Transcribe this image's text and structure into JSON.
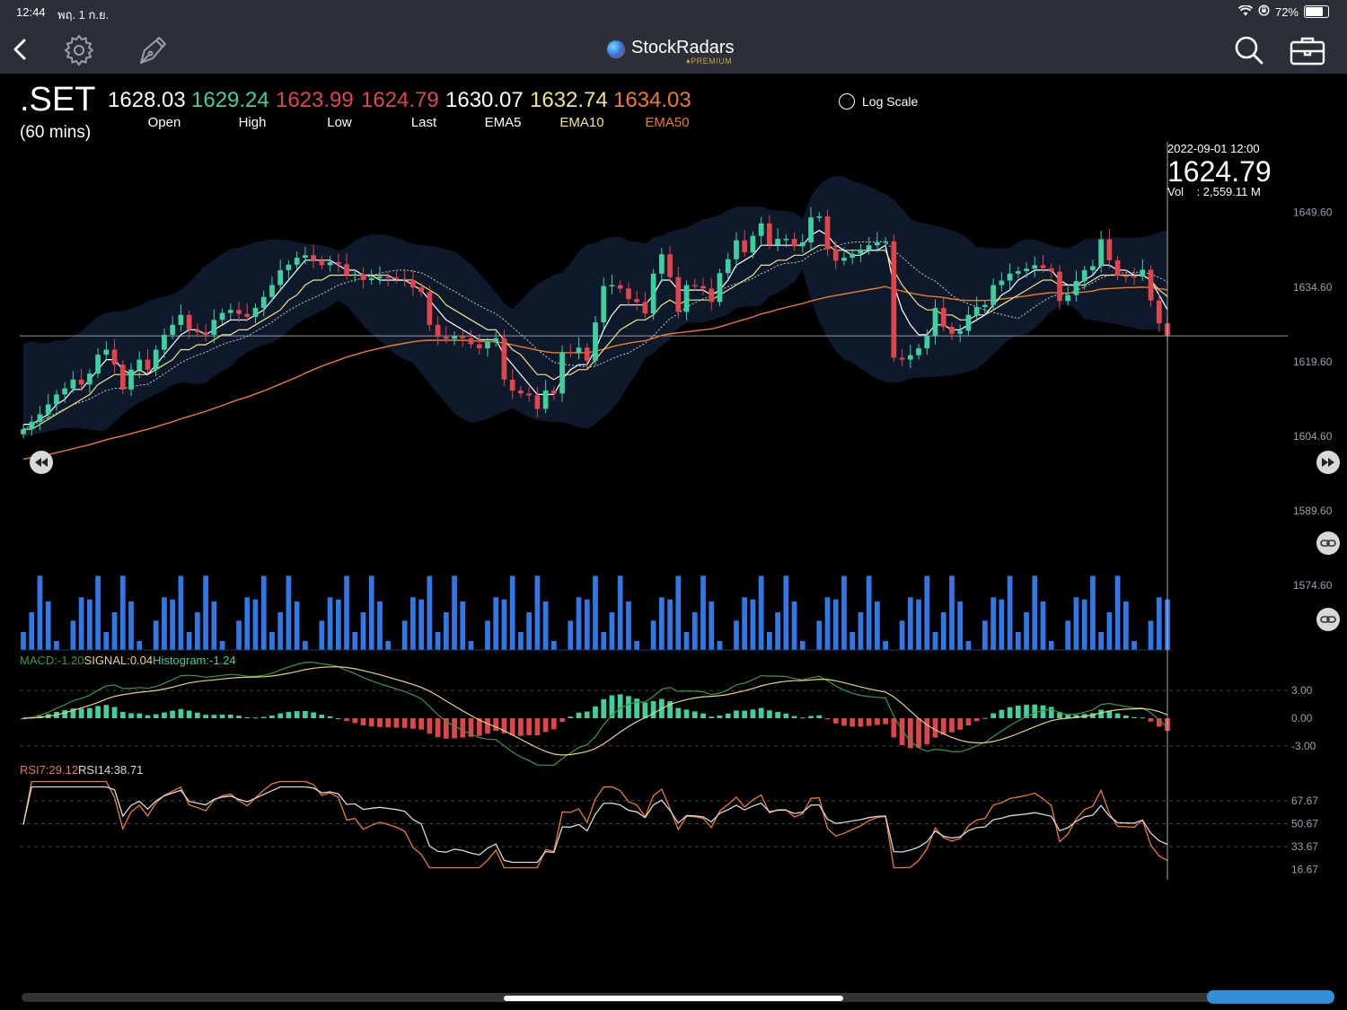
{
  "status_bar": {
    "time": "12:44",
    "date": "พฤ. 1 ก.ย.",
    "battery": "72%",
    "battery_level": 0.72
  },
  "brand": {
    "name": "StockRadars",
    "tier": "PREMIUM"
  },
  "quote": {
    "symbol": ".SET",
    "interval": "(60 mins)",
    "fields": [
      {
        "label": "Open",
        "value": "1628.03",
        "color": "#ffffff"
      },
      {
        "label": "High",
        "value": "1629.24",
        "color": "#3dd1a0"
      },
      {
        "label": "Low",
        "value": "1623.99",
        "color": "#e0454b"
      },
      {
        "label": "Last",
        "value": "1624.79",
        "color": "#e0454b"
      },
      {
        "label": "EMA5",
        "value": "1630.07",
        "color": "#ffffff"
      },
      {
        "label": "EMA10",
        "value": "1632.74",
        "color": "#f2e48a"
      },
      {
        "label": "EMA50",
        "value": "1634.03",
        "color": "#ee7a2c"
      }
    ]
  },
  "log_scale": {
    "label": "Log Scale",
    "checked": false
  },
  "crosshair": {
    "datetime": "2022-09-01 12:00",
    "price": "1624.79",
    "volume": "Vol    : 2,559.11 M"
  },
  "indicators": {
    "macd": {
      "macd": "MACD:-1.20",
      "signal": "SIGNAL:0.04",
      "histogram": "Histogram:-1.24"
    },
    "rsi": {
      "rsi7": "RSI7:29.12",
      "rsi14": "RSI14:38.71"
    }
  },
  "colors": {
    "up": "#3dd1a0",
    "down": "#e0454b",
    "volume": "#2f78e6",
    "band": "#0f1b2e",
    "ema5": "#ffffff",
    "ema10": "#f2e48a",
    "ema50": "#ee7a2c",
    "macd_line": "#3a9a3a",
    "signal_line": "#e6d37a",
    "rsi7": "#ee7a2c",
    "rsi14": "#d9d9d9"
  },
  "chart_data": {
    "type": "line",
    "price_axis": {
      "ticks": [
        "1649.60",
        "1634.60",
        "1619.60",
        "1604.60",
        "1589.60",
        "1574.60"
      ],
      "ylim": [
        1571,
        1662
      ]
    },
    "macd_axis": {
      "ticks": [
        "3.00",
        "0.00",
        "-3.00"
      ]
    },
    "rsi_axis": {
      "ticks": [
        "67.67",
        "50.67",
        "33.67",
        "16.67"
      ]
    },
    "candles_close": [
      1606,
      1607.5,
      1609,
      1611,
      1613,
      1614.2,
      1616,
      1615,
      1617.2,
      1621,
      1622,
      1619,
      1614,
      1618,
      1620,
      1618,
      1622,
      1625,
      1627,
      1629,
      1626,
      1625.5,
      1625,
      1628,
      1629.4,
      1630,
      1629.2,
      1628.6,
      1630.4,
      1632.6,
      1635,
      1638,
      1639.1,
      1640.5,
      1641,
      1640,
      1639,
      1639.6,
      1639.2,
      1637,
      1637.2,
      1636,
      1636.4,
      1636.7,
      1636.5,
      1636.3,
      1636,
      1634.5,
      1633.6,
      1627,
      1624.6,
      1624.2,
      1624.8,
      1624.3,
      1623.1,
      1622.3,
      1623.5,
      1624.3,
      1616,
      1613.8,
      1613.2,
      1612.8,
      1610.1,
      1613.8,
      1613.2,
      1621.5,
      1621.4,
      1622.4,
      1619.8,
      1627.5,
      1634.8,
      1635,
      1634.3,
      1632.2,
      1631.6,
      1629.3,
      1637.3,
      1641.2,
      1636.6,
      1629.6,
      1635,
      1634.8,
      1634.3,
      1631.6,
      1637.4,
      1640.2,
      1644,
      1641.6,
      1644.9,
      1647.4,
      1643.1,
      1644.3,
      1644.3,
      1642.8,
      1643.6,
      1648.6,
      1648.8,
      1642.2,
      1639.9,
      1640.5,
      1641.3,
      1642,
      1643,
      1643.6,
      1643.8,
      1620.4,
      1620,
      1620.9,
      1622.3,
      1624.8,
      1630.4,
      1626.6,
      1625.2,
      1625.8,
      1629,
      1630.6,
      1631,
      1635,
      1635.9,
      1637.3,
      1637.8,
      1638.3,
      1639,
      1638.4,
      1637.7,
      1631.8,
      1633,
      1635.8,
      1638,
      1638.8,
      1644.2,
      1640,
      1636.9,
      1636.8,
      1636.7,
      1638.1,
      1631.9,
      1627.3,
      1624.79
    ],
    "ema5": [
      1607,
      1607,
      1608,
      1609,
      1611,
      1612,
      1614,
      1614,
      1616,
      1618,
      1620,
      1620,
      1618,
      1617,
      1618,
      1617,
      1619,
      1621,
      1623,
      1625,
      1626,
      1626,
      1625,
      1626,
      1627,
      1628,
      1628,
      1628,
      1629,
      1630,
      1632,
      1634,
      1636,
      1638,
      1640,
      1640,
      1640,
      1640,
      1639,
      1638,
      1638,
      1637,
      1637,
      1636,
      1636,
      1636,
      1636,
      1635,
      1634,
      1632,
      1630,
      1628,
      1627,
      1626,
      1625,
      1624,
      1624,
      1624,
      1621,
      1619,
      1617,
      1615,
      1613,
      1613,
      1613,
      1616,
      1618,
      1619,
      1619,
      1622,
      1626,
      1629,
      1631,
      1631,
      1631,
      1631,
      1633,
      1636,
      1636,
      1634,
      1634,
      1634,
      1634,
      1633,
      1634,
      1636,
      1639,
      1640,
      1641,
      1643,
      1643,
      1643,
      1643,
      1643,
      1643,
      1645,
      1646,
      1645,
      1643,
      1642,
      1641,
      1641,
      1642,
      1642,
      1643,
      1635,
      1630,
      1627,
      1625,
      1625,
      1627,
      1627,
      1626,
      1626,
      1627,
      1628,
      1629,
      1631,
      1633,
      1634,
      1636,
      1637,
      1638,
      1638,
      1638,
      1636,
      1635,
      1635,
      1636,
      1637,
      1639,
      1639,
      1638,
      1638,
      1637,
      1637,
      1636,
      1633,
      1630.07
    ],
    "ema10": [
      1606,
      1606,
      1607,
      1608,
      1609,
      1610,
      1611,
      1612,
      1613,
      1615,
      1616,
      1617,
      1617,
      1617,
      1617,
      1617,
      1618,
      1619,
      1620,
      1622,
      1622,
      1623,
      1623,
      1624,
      1625,
      1625,
      1626,
      1626,
      1627,
      1628,
      1629,
      1630,
      1632,
      1633,
      1635,
      1636,
      1636,
      1637,
      1637,
      1637,
      1637,
      1637,
      1637,
      1637,
      1637,
      1636,
      1636,
      1636,
      1635,
      1634,
      1633,
      1631,
      1630,
      1629,
      1628,
      1627,
      1626,
      1626,
      1624,
      1622,
      1621,
      1619,
      1617,
      1617,
      1616,
      1617,
      1617,
      1618,
      1618,
      1620,
      1622,
      1624,
      1626,
      1627,
      1628,
      1628,
      1629,
      1631,
      1632,
      1631,
      1632,
      1632,
      1632,
      1632,
      1633,
      1634,
      1635,
      1636,
      1637,
      1639,
      1639,
      1640,
      1640,
      1641,
      1641,
      1642,
      1643,
      1643,
      1642,
      1642,
      1642,
      1642,
      1642,
      1642,
      1642,
      1638,
      1635,
      1633,
      1631,
      1630,
      1630,
      1629,
      1629,
      1628,
      1628,
      1629,
      1629,
      1630,
      1631,
      1632,
      1633,
      1634,
      1635,
      1636,
      1636,
      1635,
      1635,
      1635,
      1635,
      1636,
      1637,
      1637,
      1637,
      1637,
      1637,
      1637,
      1636,
      1634,
      1632.74
    ],
    "ema50": [
      1600,
      1600.3,
      1600.6,
      1600.9,
      1601.3,
      1601.7,
      1602.1,
      1602.5,
      1602.9,
      1603.4,
      1603.9,
      1604.3,
      1604.7,
      1605.1,
      1605.6,
      1606,
      1606.5,
      1607,
      1607.5,
      1608.1,
      1608.6,
      1609.1,
      1609.6,
      1610.2,
      1610.8,
      1611.4,
      1612,
      1612.5,
      1613.1,
      1613.7,
      1614.4,
      1615.1,
      1615.8,
      1616.5,
      1617.3,
      1618,
      1618.7,
      1619.3,
      1619.9,
      1620.5,
      1621,
      1621.5,
      1621.9,
      1622.3,
      1622.7,
      1623,
      1623.3,
      1623.6,
      1623.8,
      1623.9,
      1623.9,
      1623.9,
      1623.9,
      1623.9,
      1623.8,
      1623.7,
      1623.6,
      1623.6,
      1623.3,
      1623,
      1622.6,
      1622.3,
      1621.9,
      1621.6,
      1621.4,
      1621.4,
      1621.4,
      1621.4,
      1621.4,
      1621.7,
      1622.1,
      1622.6,
      1623,
      1623.3,
      1623.6,
      1623.8,
      1624.3,
      1624.9,
      1625.2,
      1625.4,
      1625.6,
      1625.8,
      1626,
      1626.2,
      1626.6,
      1627.1,
      1627.6,
      1628.1,
      1628.6,
      1629.2,
      1629.6,
      1630.1,
      1630.5,
      1630.9,
      1631.3,
      1631.8,
      1632.2,
      1632.6,
      1632.9,
      1633.2,
      1633.5,
      1633.8,
      1634.1,
      1634.4,
      1634.7,
      1634.2,
      1633.8,
      1633.4,
      1633.1,
      1632.8,
      1632.7,
      1632.5,
      1632.2,
      1632,
      1631.9,
      1631.9,
      1631.9,
      1632,
      1632.2,
      1632.4,
      1632.6,
      1632.8,
      1633.1,
      1633.3,
      1633.5,
      1633.4,
      1633.4,
      1633.5,
      1633.6,
      1633.8,
      1634.2,
      1634.3,
      1634.4,
      1634.5,
      1634.5,
      1634.6,
      1634.5,
      1634.3,
      1634.03
    ]
  }
}
